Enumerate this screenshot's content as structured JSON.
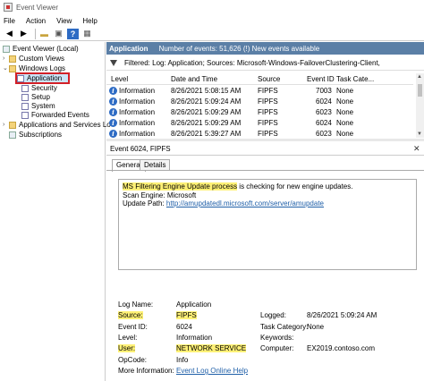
{
  "window": {
    "title": "Event Viewer"
  },
  "menu": [
    "File",
    "Action",
    "View",
    "Help"
  ],
  "tree": {
    "root": "Event Viewer (Local)",
    "custom_views": "Custom Views",
    "windows_logs": "Windows Logs",
    "items": [
      "Application",
      "Security",
      "Setup",
      "System",
      "Forwarded Events"
    ],
    "apps_services": "Applications and Services Lo",
    "subscriptions": "Subscriptions"
  },
  "header": {
    "name": "Application",
    "count": "Number of events: 51,626 (!) New events available"
  },
  "filter": {
    "text": "Filtered: Log: Application; Sources: Microsoft-Windows-FailoverClustering-Client,"
  },
  "grid": {
    "columns": [
      "Level",
      "Date and Time",
      "Source",
      "Event ID",
      "Task Cate..."
    ],
    "rows": [
      [
        "Information",
        "8/26/2021 5:08:15 AM",
        "FIPFS",
        "7003",
        "None"
      ],
      [
        "Information",
        "8/26/2021 5:09:24 AM",
        "FIPFS",
        "6024",
        "None"
      ],
      [
        "Information",
        "8/26/2021 5:09:29 AM",
        "FIPFS",
        "6023",
        "None"
      ],
      [
        "Information",
        "8/26/2021 5:09:29 AM",
        "FIPFS",
        "6024",
        "None"
      ],
      [
        "Information",
        "8/26/2021 5:39:27 AM",
        "FIPFS",
        "6023",
        "None"
      ]
    ]
  },
  "event": {
    "title": "Event 6024, FIPFS",
    "tabs": [
      "General",
      "Details"
    ],
    "message_hl": "MS Filtering Engine Update process",
    "message_rest": " is checking for new engine updates.",
    "scan_engine": "Scan Engine: Microsoft",
    "update_path_label": "Update Path: ",
    "update_path_url": "http://amupdatedl.microsoft.com/server/amupdate"
  },
  "props": {
    "log_name_label": "Log Name:",
    "log_name": "Application",
    "source_label": "Source:",
    "source": "FIPFS",
    "logged_label": "Logged:",
    "logged": "8/26/2021 5:09:24 AM",
    "event_id_label": "Event ID:",
    "event_id": "6024",
    "task_label": "Task Category:",
    "task": "None",
    "level_label": "Level:",
    "level": "Information",
    "keywords_label": "Keywords:",
    "user_label": "User:",
    "user": "NETWORK SERVICE",
    "computer_label": "Computer:",
    "computer": "EX2019.contoso.com",
    "opcode_label": "OpCode:",
    "opcode": "Info",
    "more_label": "More Information:",
    "more_link": "Event Log Online Help"
  },
  "colors": {
    "header": "#5b7fa6",
    "highlight": "#fff176",
    "selection_border": "#d32027",
    "link": "#1f5fa8"
  }
}
